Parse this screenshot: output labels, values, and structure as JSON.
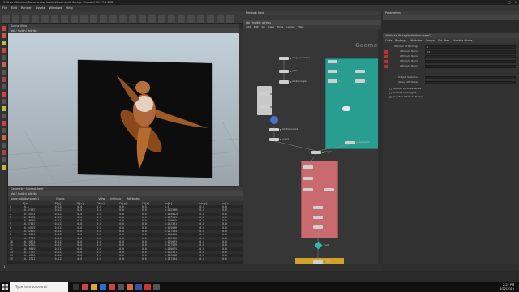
{
  "window": {
    "title": "C:/Users/Andrew/Documents/Houdini/hudini_attribs.hip - Houdini FX 17.5.258",
    "controls": [
      "–",
      "□",
      "✕"
    ]
  },
  "menubar": [
    "File",
    "Edit",
    "Render",
    "Assets",
    "Windows",
    "Help"
  ],
  "viewport": {
    "tab": "Scene View",
    "path": "obj",
    "context": "hudini_attribs"
  },
  "sheet": {
    "tab": "Geometry Spreadsheet",
    "path": "obj",
    "context": "hudini_attribs",
    "options": [
      "Node:",
      "attribwrangle1",
      "Group:",
      "View",
      "Intrinsic",
      "Attributes"
    ],
    "columns": [
      "",
      "P[x]",
      "P[y]",
      "P[z]",
      "Cd[r]",
      "Cd[g]",
      "Cd[b]",
      "uv[x]",
      "uv[y]",
      "uv[z]"
    ],
    "rows": [
      [
        "0",
        "-0.5",
        "0.113",
        "0.0",
        "0.0",
        "0.0",
        "0.0",
        "0.0",
        "0.0",
        "0.0"
      ],
      [
        "1",
        "-0.47487",
        "0.113",
        "0.0",
        "0.0",
        "0.0",
        "0.0",
        "0.0025064",
        "0.0",
        "0.0"
      ],
      [
        "2",
        "-0.44974",
        "0.113",
        "0.0",
        "0.0",
        "0.0",
        "0.0",
        "0.0050126",
        "0.0",
        "0.0"
      ],
      [
        "3",
        "-0.42462",
        "0.113",
        "0.0",
        "0.0",
        "0.0",
        "0.0",
        "0.007519",
        "0.0",
        "0.0"
      ],
      [
        "4",
        "-0.39949",
        "0.113",
        "0.0",
        "0.0",
        "0.0",
        "0.0",
        "0.010025",
        "0.0",
        "0.0"
      ],
      [
        "5",
        "-0.37437",
        "0.113",
        "0.0",
        "0.0",
        "0.0",
        "0.0",
        "0.012531",
        "0.0",
        "0.0"
      ],
      [
        "6",
        "-0.34925",
        "0.113",
        "0.0",
        "0.0",
        "0.0",
        "0.0",
        "0.015038",
        "0.0",
        "0.0"
      ],
      [
        "7",
        "-0.32412",
        "0.113",
        "0.0",
        "0.0",
        "0.0",
        "0.0",
        "0.017544",
        "0.0",
        "0.0"
      ],
      [
        "8",
        "-0.29899",
        "0.113",
        "0.0",
        "0.0",
        "0.0",
        "0.0",
        "0.020050",
        "0.0",
        "0.0"
      ],
      [
        "9",
        "-0.27387",
        "0.113",
        "0.0",
        "0.0",
        "0.0",
        "0.0",
        "0.022556",
        "0.0",
        "0.0"
      ],
      [
        "10",
        "-0.24874",
        "0.113",
        "0.0",
        "0.0",
        "0.0",
        "0.0",
        "0.025063",
        "0.0",
        "0.0"
      ],
      [
        "11",
        "-0.22362",
        "0.113",
        "0.0",
        "0.0",
        "0.0",
        "0.0",
        "0.027569",
        "0.0",
        "0.0"
      ],
      [
        "12",
        "-0.19849",
        "0.113",
        "0.0",
        "0.0",
        "0.0",
        "0.0",
        "0.030075",
        "0.0",
        "0.0"
      ],
      [
        "13",
        "-0.17337",
        "0.113",
        "0.0",
        "0.0",
        "0.0",
        "0.0",
        "0.032581",
        "0.0",
        "0.0"
      ],
      [
        "14",
        "-0.14824",
        "0.113",
        "0.0",
        "0.0",
        "0.0",
        "0.0",
        "0.035088",
        "0.0",
        "0.0"
      ],
      [
        "15",
        "-0.12312",
        "0.113",
        "0.0",
        "0.0",
        "0.0",
        "0.0",
        "0.037594",
        "0.0",
        "0.0"
      ]
    ]
  },
  "network": {
    "tab": "Network View",
    "path": "obj",
    "context": "hudini_attribs",
    "menu": [
      "Add",
      "Edit",
      "Go",
      "View",
      "Tools",
      "Layout",
      "Help"
    ],
    "label": "Geometry",
    "nodes": [
      "image_resolution",
      "grid1",
      "attribwrangle1",
      "attribwrangle2",
      "color1",
      "uvproject1",
      "merge1",
      "null1",
      "OUT"
    ]
  },
  "params": {
    "tab": "Parameters",
    "header": "Attribute Wrangle   attribwrangle1",
    "subtabs": [
      "Code",
      "Bindings",
      "Attributes",
      "Groups",
      "Ext. Pass",
      "Number Attribs"
    ],
    "number_label": "Number of Bindings",
    "number_value": "4",
    "rows": [
      {
        "label": "Attribute Name",
        "value": "Cd"
      },
      {
        "label": "Attribute Name",
        "value": ""
      },
      {
        "label": "Attribute Name",
        "value": ""
      },
      {
        "label": "Attribute Name",
        "value": ""
      }
    ],
    "group_label": "Output Selection",
    "group2_label": "Group Attributes",
    "checkboxes": [
      "Update Local Variables",
      "Enforce Prototypes",
      "Use Full Attribute Names"
    ]
  },
  "timeline": {
    "frame": "1"
  },
  "taskbar": {
    "search_placeholder": "Type here to search",
    "time": "2:22 PM",
    "date": "4/22/2019"
  }
}
